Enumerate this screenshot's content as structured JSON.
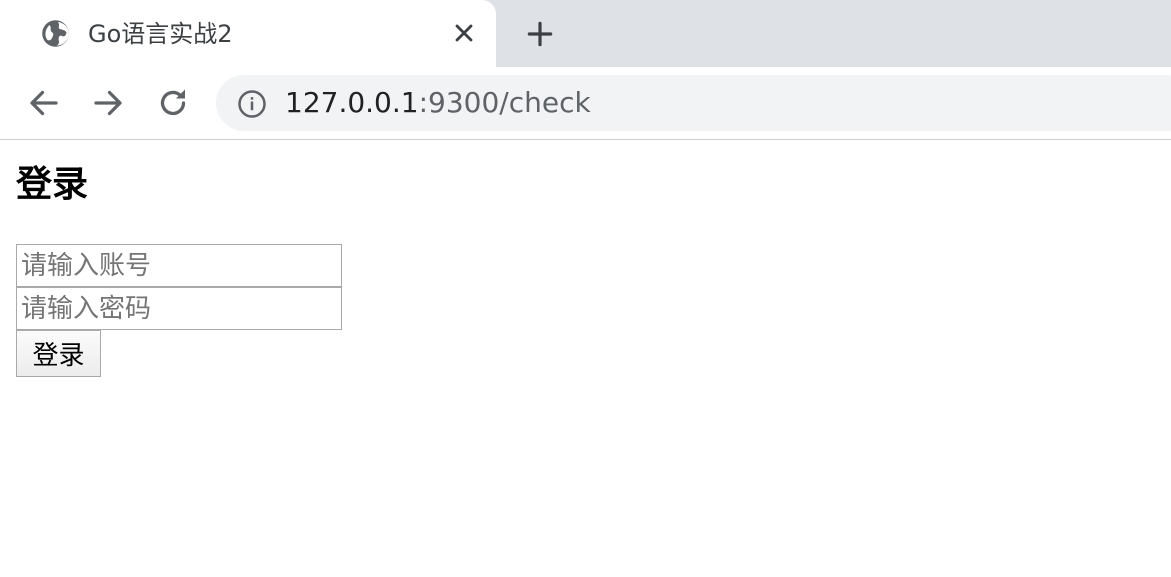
{
  "browser": {
    "tab": {
      "title": "Go语言实战2",
      "favicon": "globe-icon",
      "close_icon": "close-icon"
    },
    "new_tab_icon": "plus-icon",
    "nav": {
      "back_icon": "arrow-left-icon",
      "forward_icon": "arrow-right-icon",
      "reload_icon": "reload-icon"
    },
    "address": {
      "host": "127.0.0.1",
      "path": ":9300/check",
      "security_icon": "info-icon"
    }
  },
  "page": {
    "heading": "登录",
    "username_placeholder": "请输入账号",
    "password_placeholder": "请输入密码",
    "submit_label": "登录"
  },
  "colors": {
    "tabstrip": "#dee1e6",
    "omnibox": "#f1f3f4",
    "icon": "#5f6368"
  }
}
